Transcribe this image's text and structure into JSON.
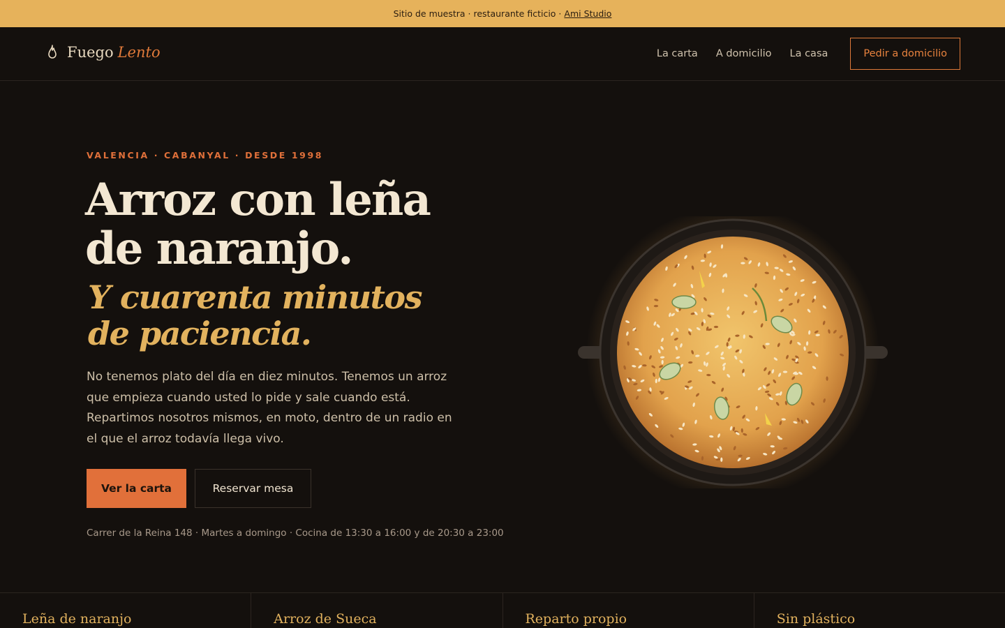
{
  "topbar": {
    "text": "Sitio de muestra · restaurante ficticio ·",
    "link": "Ami Studio"
  },
  "header": {
    "logo_word": "Fuego",
    "logo_accent": "Lento",
    "nav": [
      "La carta",
      "A domicilio",
      "La casa"
    ],
    "cta": "Pedir a domicilio"
  },
  "hero": {
    "eyebrow": "VALENCIA · CABANYAL · DESDE 1998",
    "title_line1": "Arroz con leña",
    "title_line2": "de naranjo.",
    "subtitle_line1": "Y cuarenta minutos",
    "subtitle_line2": "de paciencia.",
    "lede": "No tenemos plato del día en diez minutos. Tenemos un arroz que empieza cuando usted lo pide y sale cuando está. Repartimos nosotros mismos, en moto, dentro de un radio en el que el arroz todavía llega vivo.",
    "btn_primary": "Ver la carta",
    "btn_secondary": "Reservar mesa",
    "address": "Carrer de la Reina 148 · Martes a domingo · Cocina de 13:30 a 16:00 y de 20:30 a 23:00"
  },
  "features": [
    "Leña de naranjo",
    "Arroz de Sueca",
    "Reparto propio",
    "Sin plástico"
  ],
  "colors": {
    "background": "#14100d",
    "accent_orange": "#e1703a",
    "accent_gold": "#e2b25e",
    "topbar": "#e6b25b"
  },
  "icons": {
    "logo": "flame-icon",
    "hero_image": "paella-pan-illustration"
  }
}
